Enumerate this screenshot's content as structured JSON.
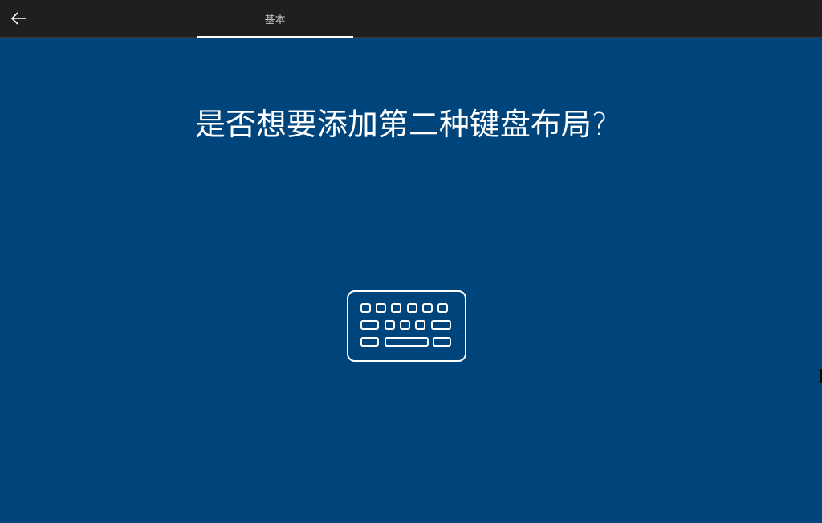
{
  "header": {
    "back_icon": "arrow-left-icon",
    "tab_label": "基本"
  },
  "main": {
    "title": "是否想要添加第二种键盘布局?",
    "illustration_icon": "keyboard-icon"
  },
  "colors": {
    "background": "#00447c",
    "topbar": "#1f1f1f",
    "text": "#ffffff",
    "tab_text": "#c8c8c8"
  }
}
